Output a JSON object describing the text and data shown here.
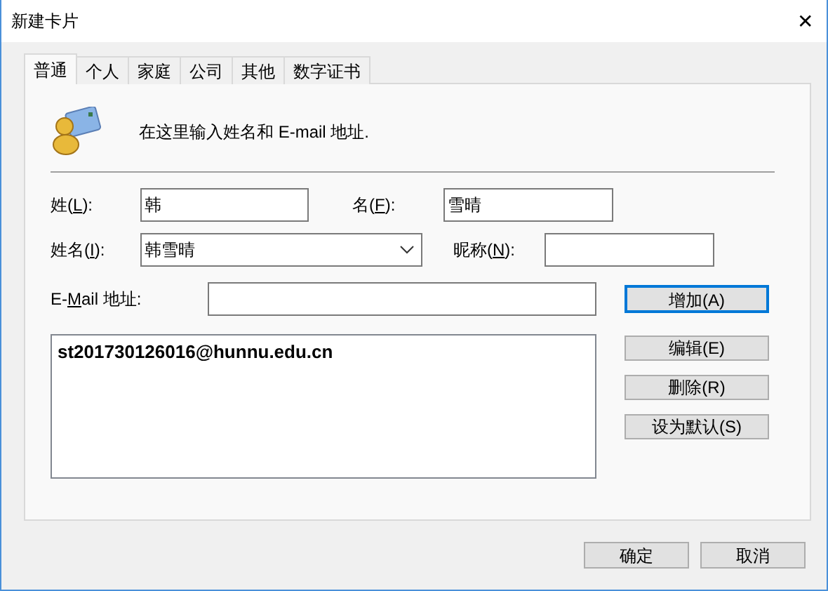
{
  "window": {
    "title": "新建卡片",
    "close": "✕"
  },
  "tabs": [
    {
      "label": "普通",
      "selected": true
    },
    {
      "label": "个人",
      "selected": false
    },
    {
      "label": "家庭",
      "selected": false
    },
    {
      "label": "公司",
      "selected": false
    },
    {
      "label": "其他",
      "selected": false
    },
    {
      "label": "数字证书",
      "selected": false
    }
  ],
  "intro": "在这里输入姓名和 E-mail 地址.",
  "fields": {
    "last_name": {
      "label": {
        "pre": "姓(",
        "key": "L",
        "post": "):"
      },
      "value": "韩"
    },
    "first_name": {
      "label": {
        "pre": "名(",
        "key": "F",
        "post": "):"
      },
      "value": "雪晴"
    },
    "full_name": {
      "label": {
        "pre": "姓名(",
        "key": "I",
        "post": "):"
      },
      "value": "韩雪晴"
    },
    "nickname": {
      "label": {
        "pre": "昵称(",
        "key": "N",
        "post": "):"
      }
    },
    "email": {
      "label": {
        "pre": "E-",
        "key": "M",
        "post": "ail 地址:"
      }
    }
  },
  "add_button": {
    "label": "增加(A)",
    "default": true
  },
  "email_list": [
    {
      "text": "st201730126016@hunnu.edu.cn",
      "default": true
    }
  ],
  "side_buttons": [
    "编辑(E)",
    "删除(R)",
    "设为默认(S)"
  ],
  "footer_buttons": [
    "确定",
    "取消"
  ]
}
